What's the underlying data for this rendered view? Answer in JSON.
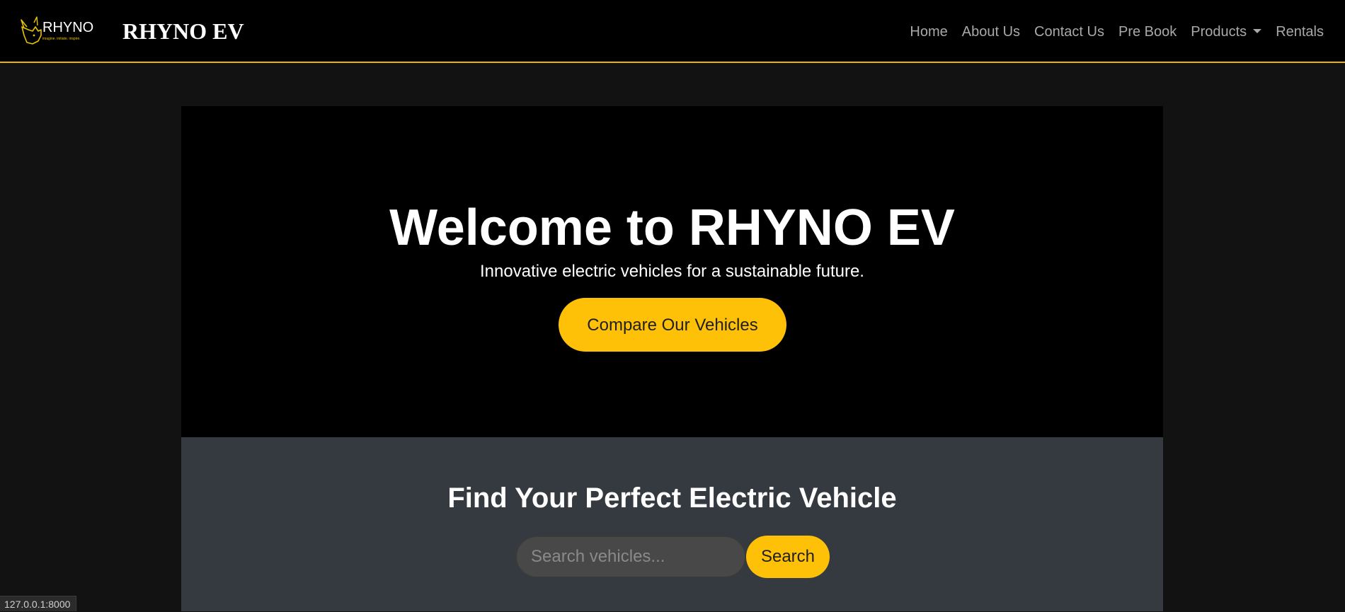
{
  "brand": {
    "logo_text": "RHYNO",
    "logo_tagline": "imagine. initiate. inspire.",
    "name": "RHYNO EV"
  },
  "nav": {
    "items": [
      "Home",
      "About Us",
      "Contact Us",
      "Pre Book",
      "Products",
      "Rentals"
    ]
  },
  "hero": {
    "title": "Welcome to RHYNO EV",
    "subtitle": "Innovative electric vehicles for a sustainable future.",
    "cta_label": "Compare Our Vehicles"
  },
  "search": {
    "title": "Find Your Perfect Electric Vehicle",
    "placeholder": "Search vehicles...",
    "button_label": "Search"
  },
  "status_bar": {
    "url": "127.0.0.1:8000"
  },
  "colors": {
    "accent": "#ffc107",
    "navbar_bg": "#000000",
    "page_bg": "#121212",
    "section_bg": "#343a40",
    "nav_link": "#a9a9a9"
  }
}
